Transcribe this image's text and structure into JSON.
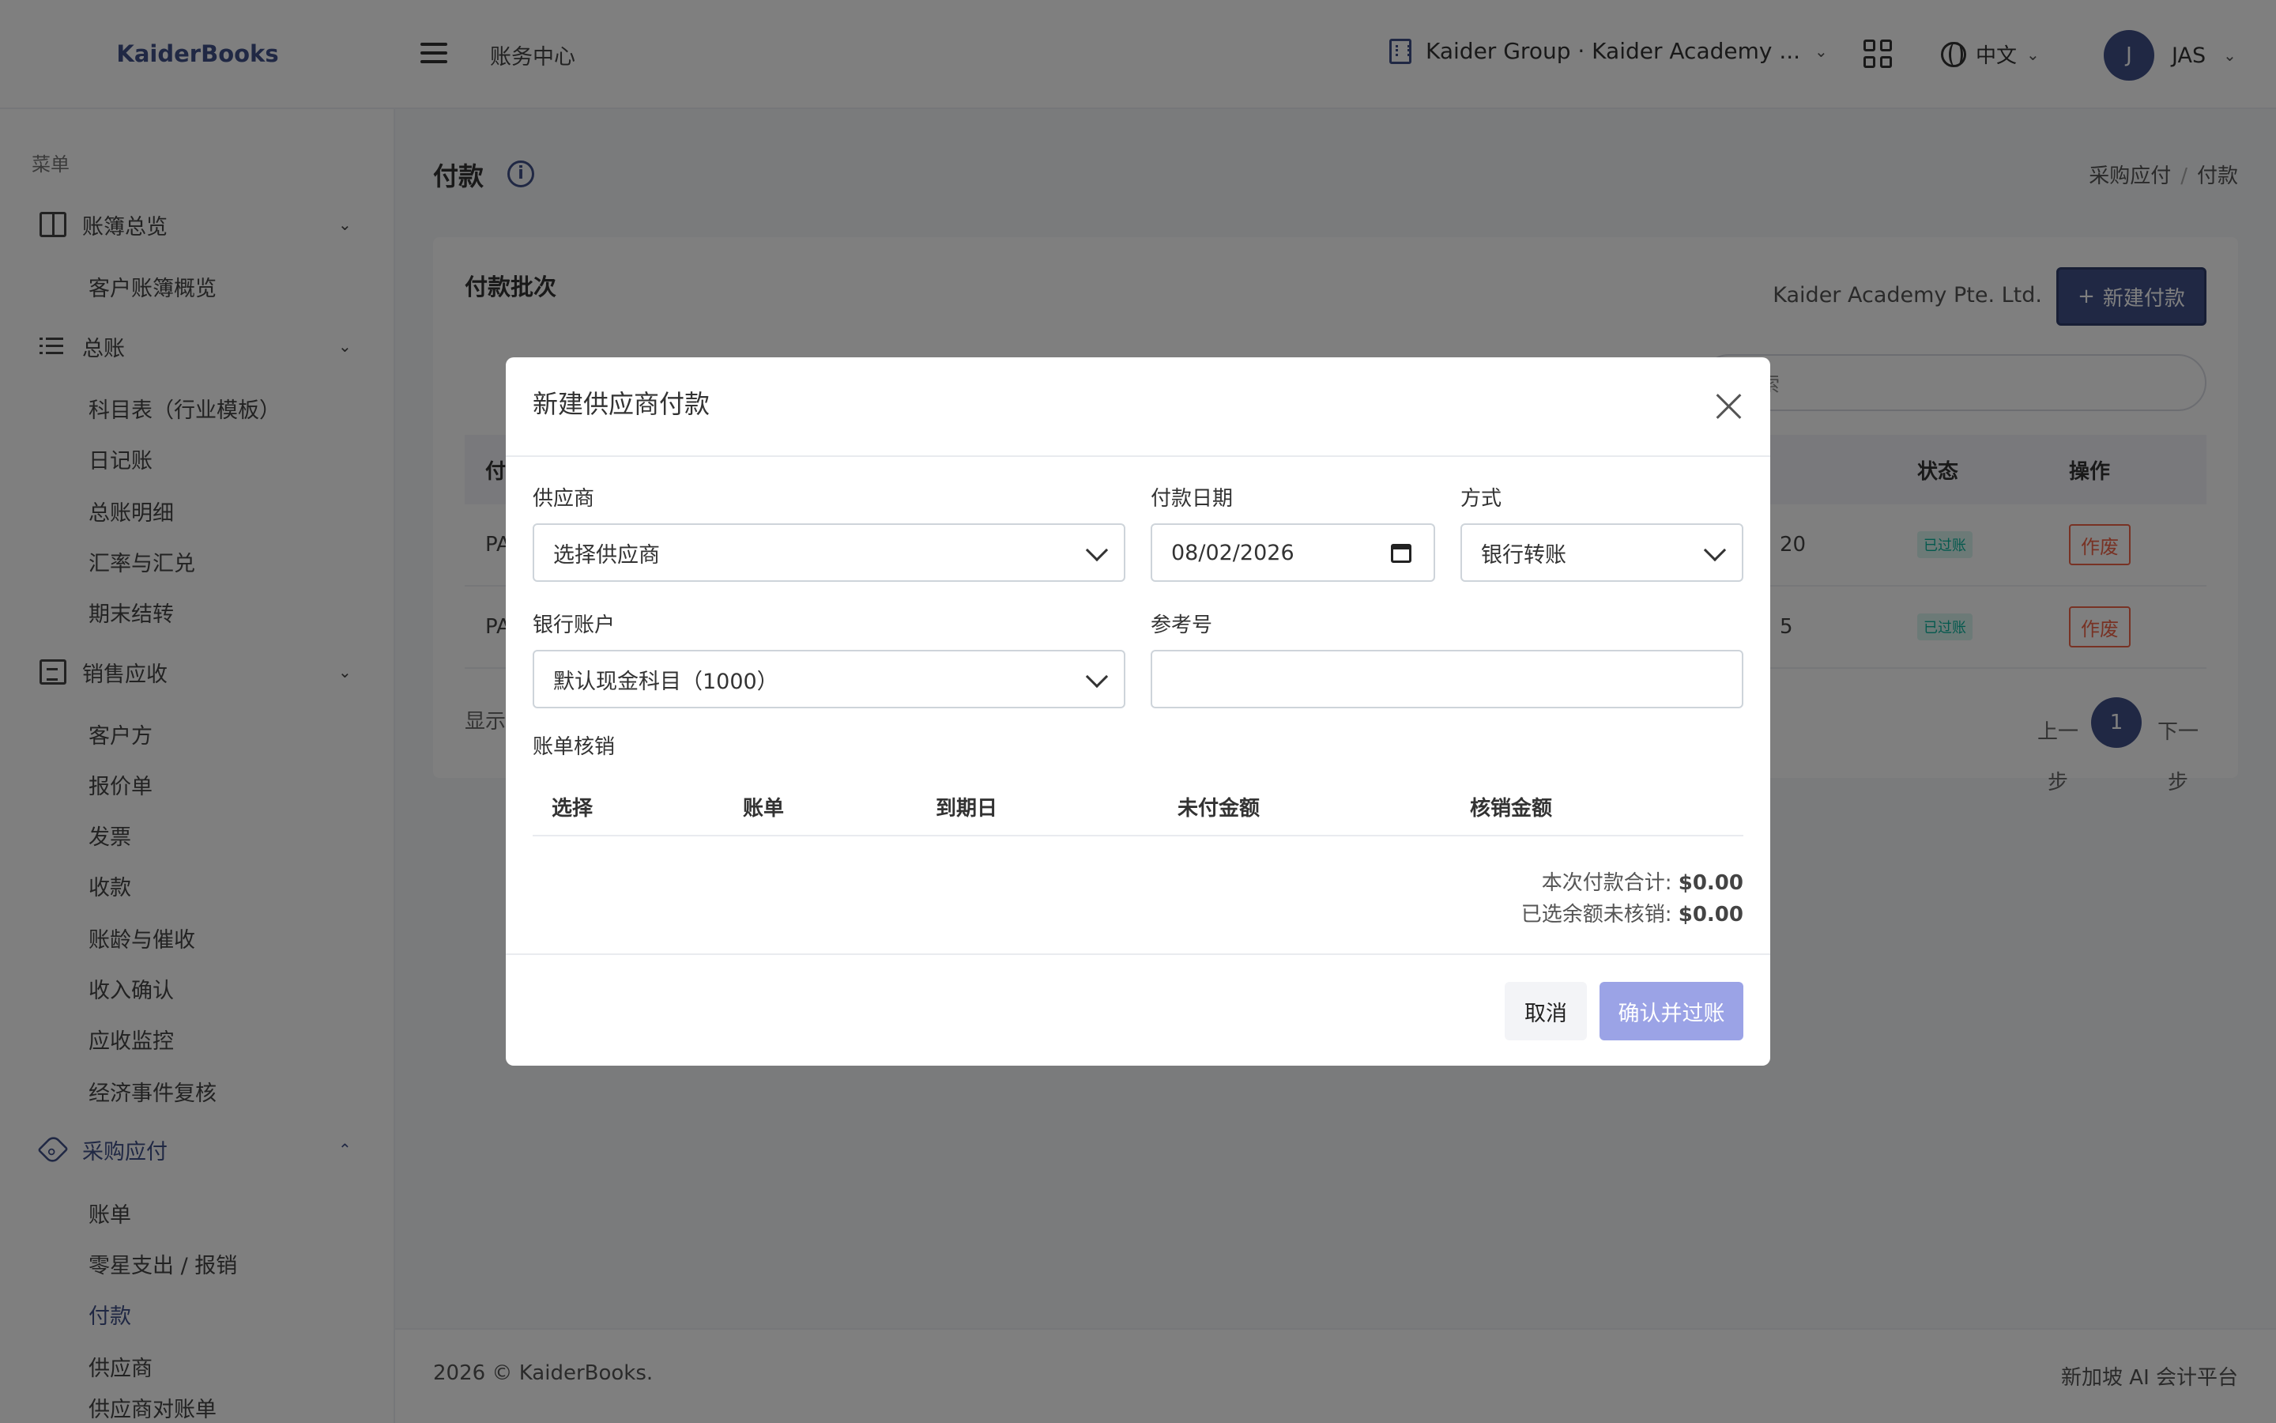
{
  "header": {
    "brand": "KaiderBooks",
    "section": "账务中心",
    "org": "Kaider Group · Kaider Academy ...",
    "lang": "中文",
    "user_initial": "J",
    "user_name": "JAS"
  },
  "sidebar": {
    "menu_title": "菜单",
    "groups": [
      {
        "label": "账簿总览",
        "items": [
          "客户账簿概览"
        ]
      },
      {
        "label": "总账",
        "items": [
          "科目表（行业模板）",
          "日记账",
          "总账明细",
          "汇率与汇兑",
          "期末结转"
        ]
      },
      {
        "label": "销售应收",
        "items": [
          "客户方",
          "报价单",
          "发票",
          "收款",
          "账龄与催收",
          "收入确认",
          "应收监控",
          "经济事件复核"
        ]
      },
      {
        "label": "采购应付",
        "items": [
          "账单",
          "零星支出 / 报销",
          "付款",
          "供应商",
          "供应商对账单"
        ]
      }
    ]
  },
  "page": {
    "title": "付款",
    "breadcrumb": [
      "采购应付",
      "付款"
    ]
  },
  "card": {
    "title": "付款批次",
    "company": "Kaider Academy Pte. Ltd.",
    "new_button": "新建付款",
    "search_placeholder": "搜索",
    "columns": [
      "付",
      "状态",
      "操作"
    ],
    "rows": [
      {
        "ref": "PA",
        "amount": "20",
        "status": "已过账",
        "action": "作废"
      },
      {
        "ref": "PA",
        "amount": "5",
        "status": "已过账",
        "action": "作废"
      }
    ],
    "showing": "显示",
    "pager": {
      "prev": "上一步",
      "current": "1",
      "next": "下一步"
    }
  },
  "footer": {
    "left": "2026 © KaiderBooks.",
    "right": "新加坡 AI 会计平台"
  },
  "modal": {
    "title": "新建供应商付款",
    "supplier_label": "供应商",
    "supplier_value": "选择供应商",
    "date_label": "付款日期",
    "date_value": "08/02/2026",
    "method_label": "方式",
    "method_value": "银行转账",
    "bank_label": "银行账户",
    "bank_value": "默认现金科目（1000）",
    "ref_label": "参考号",
    "ref_value": "",
    "allocation_label": "账单核销",
    "columns": [
      "选择",
      "账单",
      "到期日",
      "未付金额",
      "核销金额"
    ],
    "total_label": "本次付款合计:",
    "total_value": "$0.00",
    "unallocated_label": "已选余额未核销:",
    "unallocated_value": "$0.00",
    "cancel": "取消",
    "confirm": "确认并过账"
  }
}
